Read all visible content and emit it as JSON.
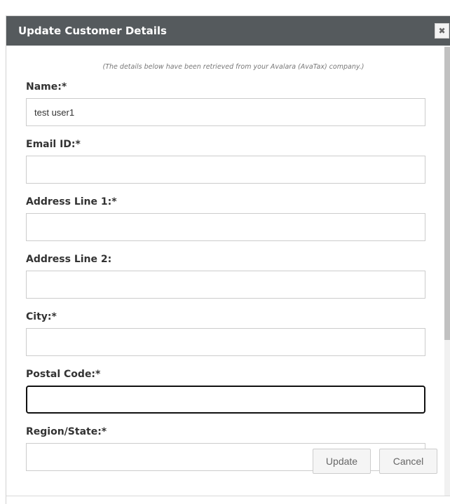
{
  "dialog": {
    "title": "Update Customer Details",
    "close_symbol": "✖",
    "note": "(The details below have been retrieved from your Avalara (AvaTax) company.)"
  },
  "fields": {
    "name": {
      "label": "Name:*",
      "value": "test user1"
    },
    "email": {
      "label": "Email ID:*",
      "value": ""
    },
    "address1": {
      "label": "Address Line 1:*",
      "value": ""
    },
    "address2": {
      "label": "Address Line 2:",
      "value": ""
    },
    "city": {
      "label": "City:*",
      "value": ""
    },
    "postal_code": {
      "label": "Postal Code:*",
      "value": ""
    },
    "region": {
      "label": "Region/State:*",
      "value": ""
    }
  },
  "footer": {
    "update_label": "Update",
    "cancel_label": "Cancel"
  },
  "colors": {
    "titlebar": "#555a5d",
    "focused_border": "#111111"
  }
}
